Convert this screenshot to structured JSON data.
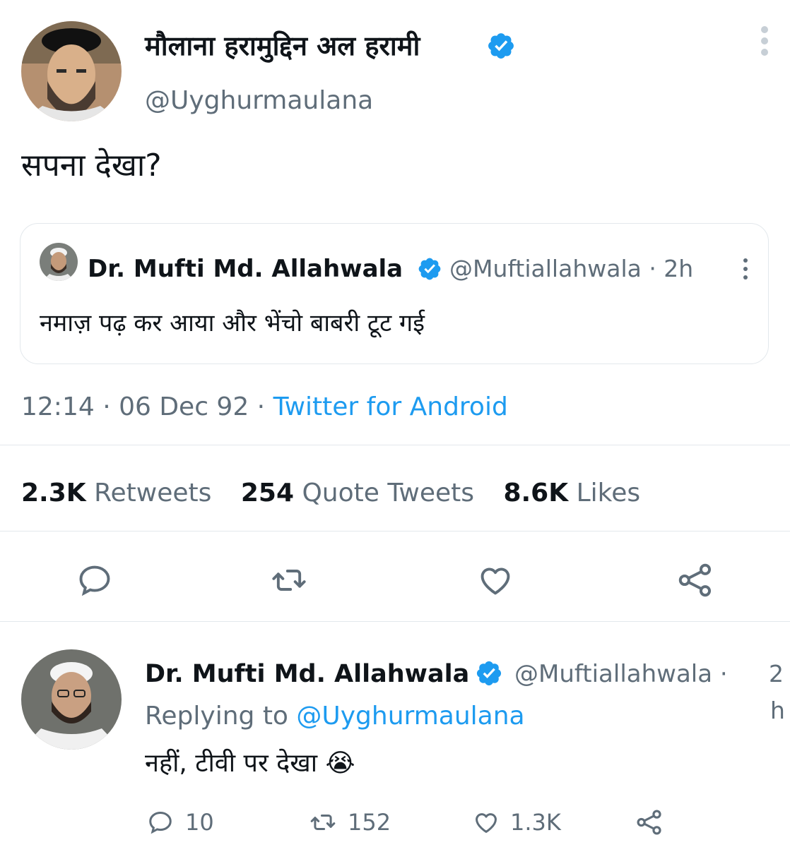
{
  "main_tweet": {
    "author_name": "मौलाना हरामुद्दिन अल हरामी",
    "handle": "@Uyghurmaulana",
    "text": "सपना देखा?",
    "quoted": {
      "author_name": "Dr. Mufti Md. Allahwala",
      "handle_time": "@Muftiallahwala · 2h",
      "text": "नमाज़ पढ़ कर आया और भेंचो बाबरी टूट गई"
    },
    "time": "12:14 · 06 Dec 92 · ",
    "client": "Twitter for Android",
    "stats": {
      "retweets_count": "2.3K",
      "retweets_label": "Retweets",
      "quotes_count": "254",
      "quotes_label": "Quote Tweets",
      "likes_count": "8.6K",
      "likes_label": "Likes"
    }
  },
  "reply": {
    "author_name": "Dr. Mufti Md. Allahwala",
    "handle": "@Muftiallahwala ·",
    "time_a": "2",
    "time_b": "h",
    "replying_prefix": "Replying to ",
    "replying_handle": "@Uyghurmaulana",
    "text": "नहीं, टीवी पर देखा 😭",
    "reply_count": "10",
    "retweet_count": "152",
    "like_count": "1.3K"
  },
  "colors": {
    "accent": "#1d9bf0",
    "muted": "#5f6d79",
    "text": "#0f1419"
  },
  "icons": [
    "verified-icon",
    "more-icon",
    "reply-icon",
    "retweet-icon",
    "like-icon",
    "share-icon"
  ]
}
